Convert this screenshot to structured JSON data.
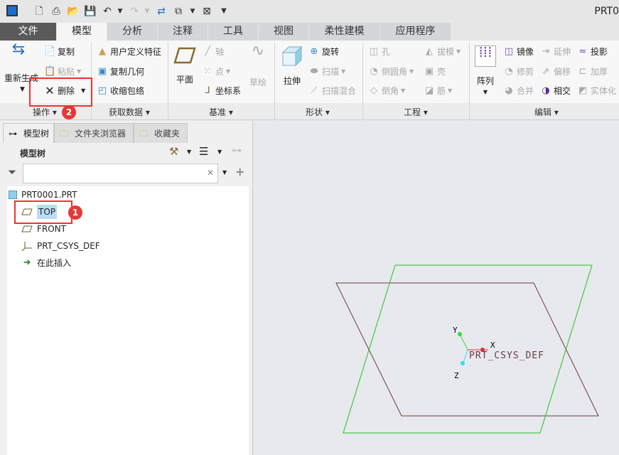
{
  "window": {
    "title": "PRT0"
  },
  "quick_access": [
    "app-icon",
    "new-icon",
    "print-icon",
    "open-icon",
    "save-icon",
    "undo-icon",
    "redo-icon",
    "regenerate-icon",
    "windows-icon",
    "close-window-icon",
    "customize-icon"
  ],
  "tabs": [
    {
      "label": "文件"
    },
    {
      "label": "模型"
    },
    {
      "label": "分析"
    },
    {
      "label": "注释"
    },
    {
      "label": "工具"
    },
    {
      "label": "视图"
    },
    {
      "label": "柔性建模"
    },
    {
      "label": "应用程序"
    }
  ],
  "ribbon": {
    "operations": {
      "label": "操作",
      "regenerate": "重新生成",
      "copy": "复制",
      "paste": "粘贴",
      "delete": "删除"
    },
    "get_data": {
      "label": "获取数据",
      "udf": "用户定义特征",
      "copy_geom": "复制几何",
      "shrinkwrap": "收缩包络"
    },
    "datum": {
      "label": "基准",
      "plane": "平面",
      "axis": "轴",
      "point": "点",
      "csys": "坐标系",
      "sketch": "草绘"
    },
    "shapes": {
      "label": "形状",
      "extrude": "拉伸",
      "revolve": "旋转",
      "sweep": "扫描",
      "swept_blend": "扫描混合"
    },
    "engineering": {
      "label": "工程",
      "hole": "孔",
      "round": "倒圆角",
      "chamfer": "倒角",
      "draft": "拔模",
      "shell": "壳",
      "rib": "筋"
    },
    "editing": {
      "label": "编辑",
      "pattern": "阵列",
      "mirror": "镜像",
      "trim": "修剪",
      "merge": "合并",
      "extend": "延伸",
      "offset": "偏移",
      "intersect": "相交",
      "project": "投影",
      "thicken": "加厚",
      "solidify": "实体化"
    }
  },
  "panel": {
    "tabs": [
      {
        "label": "模型树"
      },
      {
        "label": "文件夹浏览器"
      },
      {
        "label": "收藏夹"
      }
    ],
    "title": "模型树",
    "search": {
      "value": "",
      "placeholder": ""
    },
    "tree": [
      {
        "label": "PRT0001.PRT",
        "icon": "part-icon"
      },
      {
        "label": "TOP",
        "icon": "plane-icon",
        "selected": true
      },
      {
        "label": "FRONT",
        "icon": "plane-icon"
      },
      {
        "label": "PRT_CSYS_DEF",
        "icon": "csys-icon"
      },
      {
        "label": "在此插入",
        "icon": "insert-arrow-icon"
      }
    ]
  },
  "graphics": {
    "csys_label": "PRT_CSYS_DEF",
    "axes": {
      "x": "X",
      "y": "Y",
      "z": "Z"
    },
    "colors": {
      "top_plane": "#6b3a3a",
      "front_plane": "#22c022",
      "x_axis": "#e03030",
      "y_axis": "#33dd33",
      "z_axis": "#33ddee"
    }
  },
  "annotations": {
    "step1": "1",
    "step2": "2"
  }
}
